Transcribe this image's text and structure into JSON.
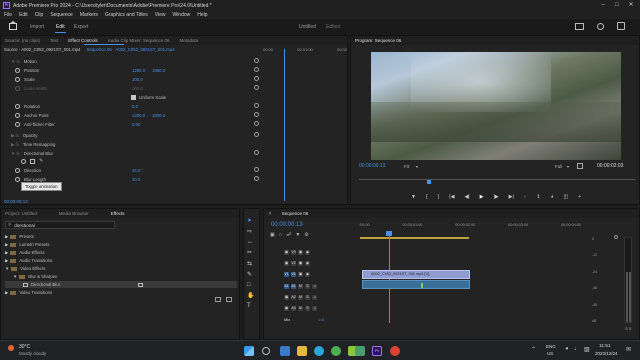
{
  "titlebar": {
    "title": "Adobe Premiere Pro 2024 - C:\\Users\\tyler\\Documents\\Adobe\\Premiere Pro\\24.0\\Untitled *"
  },
  "menu": [
    "File",
    "Edit",
    "Clip",
    "Sequence",
    "Markers",
    "Graphics and Titles",
    "View",
    "Window",
    "Help"
  ],
  "workspaces": {
    "import": "Import",
    "edit": "Edit",
    "export": "Export",
    "doc_title": "Untitled",
    "doc_status": "Edited"
  },
  "source_panel": {
    "tabs": [
      "Source: (no clips)",
      "Text",
      "Effect Controls",
      "Audio Clip Mixer: Sequence 06",
      "Metadata"
    ],
    "clip_path": "Source · A002_C052_0921ST_001.mp4",
    "sequence_ref": "Sequence 06 · A002_C052_0921ST_001.mp4",
    "ruler": [
      "00:00",
      "00:01:00",
      "00:02"
    ],
    "rows": [
      {
        "label": "Motion",
        "vals": []
      },
      {
        "label": "Position",
        "vals": [
          "1280.0",
          "1880.0"
        ]
      },
      {
        "label": "Scale",
        "vals": [
          "100.0"
        ]
      },
      {
        "label": "Scale Width",
        "vals": [
          "100.0"
        ]
      },
      {
        "label": "",
        "vals": [
          "Uniform Scale"
        ]
      },
      {
        "label": "Rotation",
        "vals": [
          "0.0"
        ]
      },
      {
        "label": "Anchor Point",
        "vals": [
          "1280.0",
          "1800.0"
        ]
      },
      {
        "label": "Anti-flicker Filter",
        "vals": [
          "0.00"
        ]
      },
      {
        "label": "Opacity",
        "vals": []
      },
      {
        "label": "Time Remapping",
        "vals": []
      },
      {
        "label": "Directional Blur",
        "vals": []
      },
      {
        "label": "",
        "vals": []
      },
      {
        "label": "Direction",
        "vals": [
          "45.0 °"
        ]
      },
      {
        "label": "Blur Length",
        "vals": [
          "20.0"
        ]
      }
    ],
    "tooltip": "Toggle animation",
    "timecode": "00:00:00:13"
  },
  "program": {
    "tab": "Program: Sequence 06",
    "timecode": "00:00:00:13",
    "fit": "Fit",
    "quality": "Full",
    "duration": "00:00:02:03"
  },
  "project": {
    "tabs": [
      "Project: Untitled",
      "Media Browser",
      "Effects"
    ],
    "search": "directional",
    "tree": [
      {
        "label": "Presets",
        "indent": 0
      },
      {
        "label": "Lumetri Presets",
        "indent": 0
      },
      {
        "label": "Audio Effects",
        "indent": 0
      },
      {
        "label": "Audio Transitions",
        "indent": 0
      },
      {
        "label": "Video Effects",
        "indent": 0
      },
      {
        "label": "Blur & Sharpen",
        "indent": 1
      },
      {
        "label": "Directional Blur",
        "indent": 2
      },
      {
        "label": "Video Transitions",
        "indent": 0
      }
    ]
  },
  "timeline": {
    "tab": "Sequence 06",
    "timecode": "00:00:00:13",
    "ruler": [
      ":00:00",
      "00:00:01:00",
      "00:00:02:00",
      "00:00:03:00",
      "00:00:04:00"
    ],
    "tracks": [
      "V3",
      "V2",
      "V1",
      "A1",
      "A2",
      "A3"
    ],
    "mix_label": "Mix",
    "mix_value": "0.0",
    "clip_label": "A002_C052_0921ST_001.mp4 [V]",
    "db": [
      "0",
      "-12",
      "-24",
      "-36",
      "-48",
      "dB"
    ]
  },
  "taskbar": {
    "weather_temp": "30°C",
    "weather_desc": "Mostly cloudy",
    "lang_top": "ENG",
    "lang_bottom": "US",
    "time": "11:51",
    "date": "2023/12/24"
  },
  "colors": {
    "accent": "#4a90e2",
    "clip_video": "#8f9bd1",
    "clip_audio": "#3a6f9a"
  }
}
